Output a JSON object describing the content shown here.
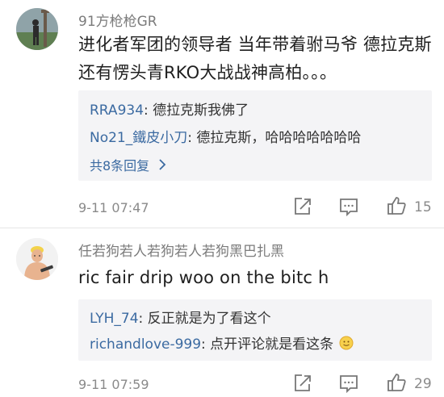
{
  "comments": [
    {
      "username": "91方枪枪GR",
      "text": "进化者军团的领导者 当年带着驸马爷 德拉克斯 还有愣头青RKO大战战神高柏。。。",
      "replies": [
        {
          "user": "RRA934",
          "text": ": 德拉克斯我佛了"
        },
        {
          "user": "No21_鐵皮小刀",
          "text": ": 德拉克斯，哈哈哈哈哈哈哈"
        }
      ],
      "more_replies": "共8条回复",
      "more_icon": "chevron-right-icon",
      "time": "9-11 07:47",
      "likes": "15"
    },
    {
      "username": "任若狗若人若狗若人若狗黑巴扎黑",
      "text": "ric fair drip woo on the bitc h",
      "replies": [
        {
          "user": "LYH_74",
          "text": ": 反正就是为了看这个"
        },
        {
          "user": "richandlove-999",
          "text": ": 点开评论就是看这条"
        }
      ],
      "time": "9-11 07:59",
      "likes": "29"
    }
  ],
  "icons": {
    "share": "share-icon",
    "comment": "comment-icon",
    "like": "thumbs-up-icon"
  },
  "colors": {
    "link": "#3b6aa1",
    "meta": "#8a8a8a",
    "reply_bg": "#f4f4f6"
  }
}
